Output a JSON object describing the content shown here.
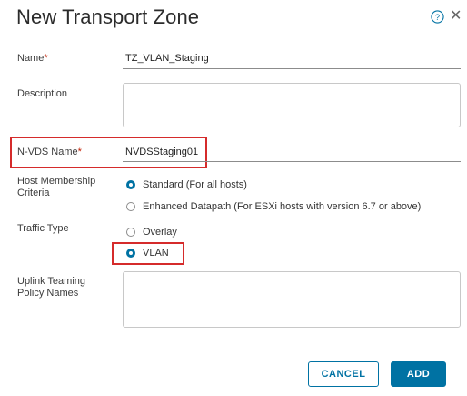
{
  "dialog": {
    "title": "New Transport Zone"
  },
  "fields": {
    "name_label": "Name",
    "name_required": "*",
    "name_value": "TZ_VLAN_Staging",
    "description_label": "Description",
    "description_value": "",
    "nvds_label": "N-VDS Name",
    "nvds_required": "*",
    "nvds_value": "NVDSStaging01",
    "host_membership_label_line1": "Host Membership",
    "host_membership_label_line2": "Criteria",
    "host_membership_options": [
      {
        "label": "Standard (For all hosts)",
        "checked": true
      },
      {
        "label": "Enhanced Datapath (For ESXi hosts with version 6.7 or above)",
        "checked": false
      }
    ],
    "traffic_type_label": "Traffic Type",
    "traffic_type_options": [
      {
        "label": "Overlay",
        "checked": false
      },
      {
        "label": "VLAN",
        "checked": true
      }
    ],
    "uplink_label_line1": "Uplink Teaming",
    "uplink_label_line2": "Policy Names",
    "uplink_value": ""
  },
  "buttons": {
    "cancel_label": "CANCEL",
    "add_label": "ADD"
  },
  "icons": {
    "help": "help-circle-icon",
    "close": "close-icon"
  },
  "colors": {
    "accent": "#0072a3",
    "highlight": "#d52b2b",
    "required": "#c21d00"
  }
}
